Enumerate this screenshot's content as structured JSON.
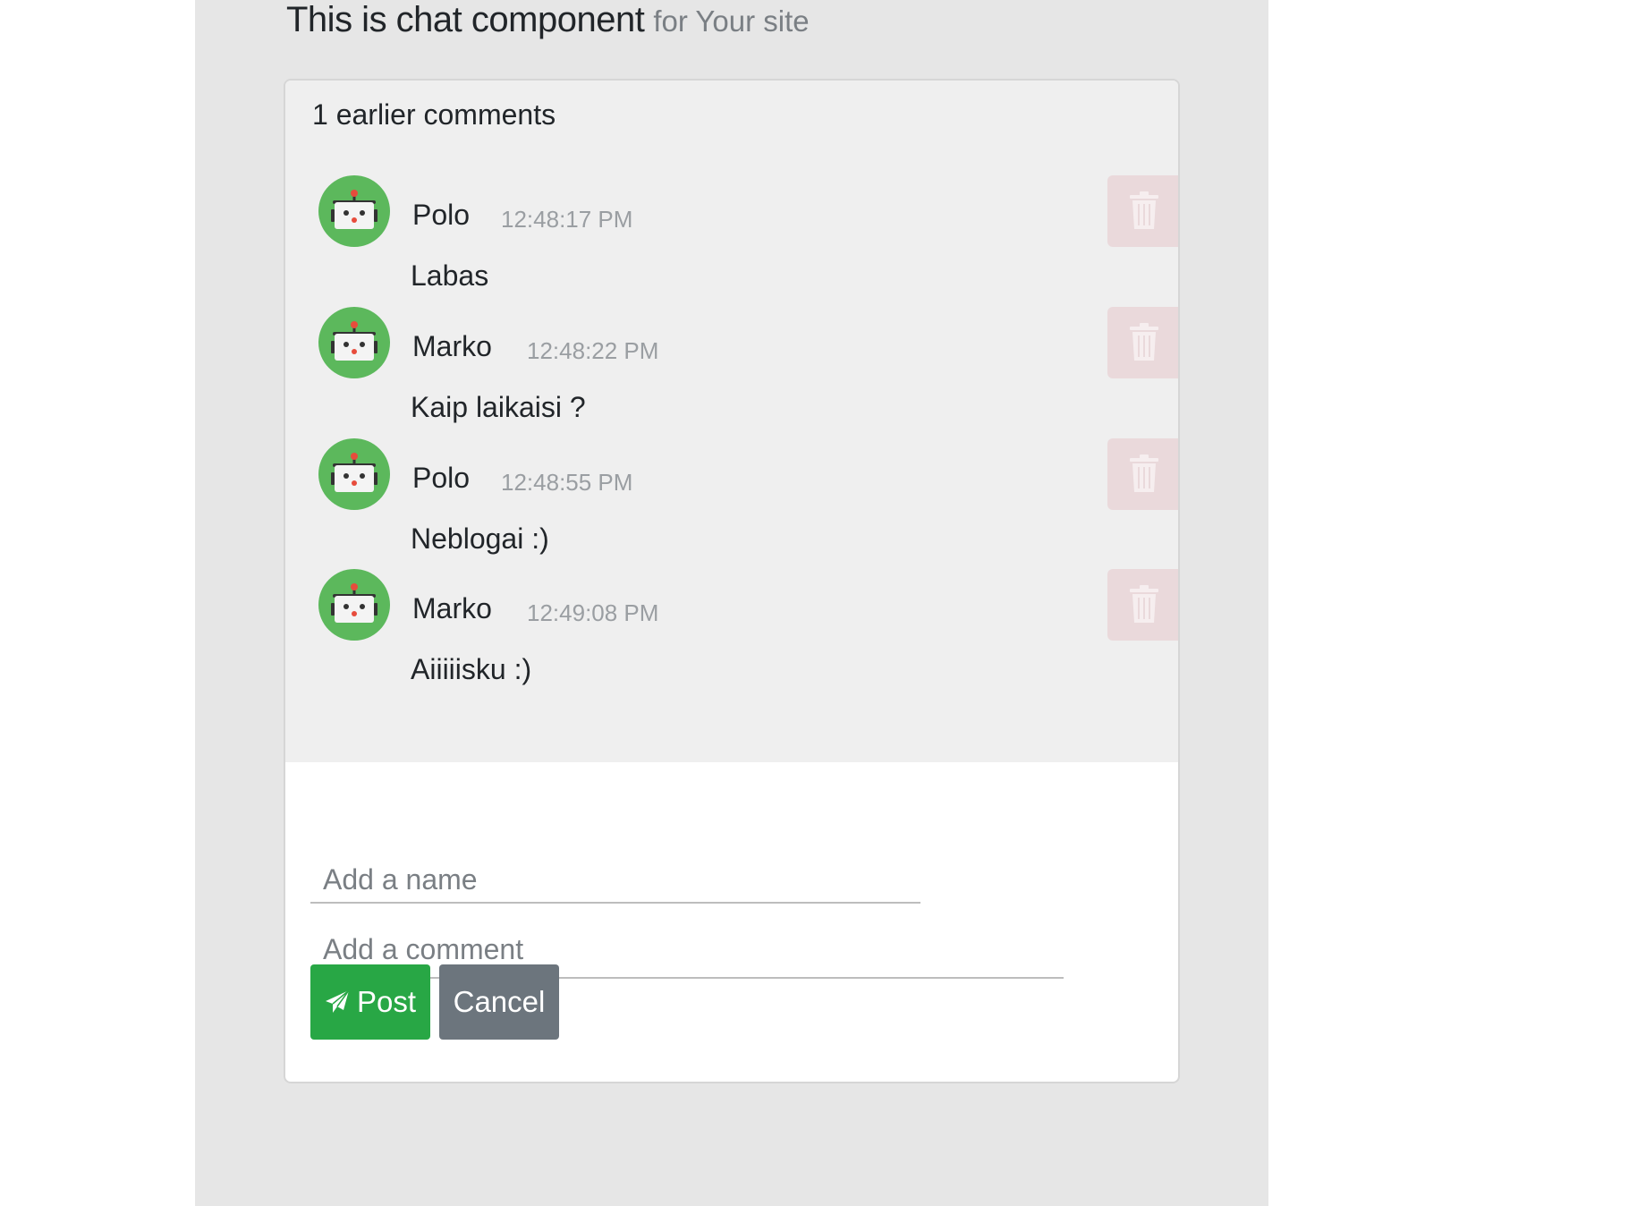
{
  "header": {
    "title": "This is chat component",
    "subtitle": "for Your site"
  },
  "chat": {
    "earlier_label": "1 earlier comments",
    "comments": [
      {
        "author": "Polo",
        "time": "12:48:17 PM",
        "text": "Labas"
      },
      {
        "author": "Marko",
        "time": "12:48:22 PM",
        "text": "Kaip laikaisi ?"
      },
      {
        "author": "Polo",
        "time": "12:48:55 PM",
        "text": "Neblogai :)"
      },
      {
        "author": "Marko",
        "time": "12:49:08 PM",
        "text": "Aiiiiisku :)"
      }
    ],
    "avatar_icon": "robot-icon",
    "delete_icon": "trash-icon"
  },
  "form": {
    "name_placeholder": "Add a name",
    "name_value": "",
    "comment_placeholder": "Add a comment",
    "comment_value": "",
    "post_label": "Post",
    "post_icon": "paper-plane-icon",
    "cancel_label": "Cancel"
  },
  "colors": {
    "avatar_bg": "#5cb85c",
    "post_button": "#28a745",
    "cancel_button": "#6c757d",
    "delete_button": "#ead9db"
  }
}
